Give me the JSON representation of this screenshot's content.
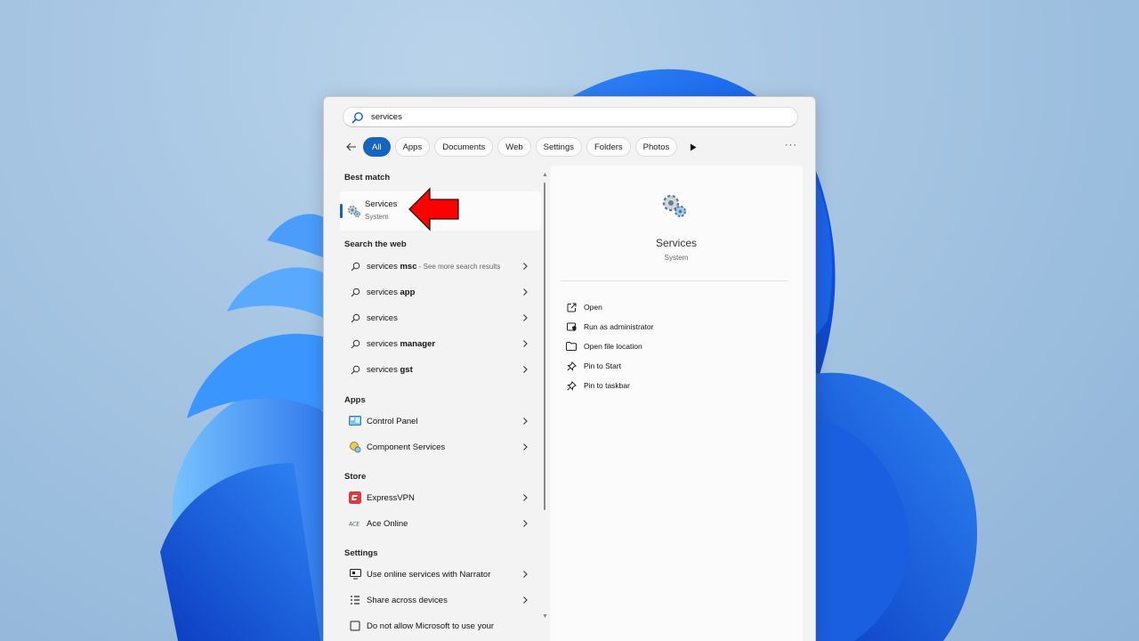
{
  "search": {
    "query": "services"
  },
  "filters": {
    "back_icon": "back-arrow-icon",
    "chips": [
      "All",
      "Apps",
      "Documents",
      "Web",
      "Settings",
      "Folders",
      "Photos"
    ],
    "more_label": "···"
  },
  "results": {
    "best_match_heading": "Best match",
    "best_match": {
      "title": "Services",
      "subtitle": "System",
      "icon": "services-gear-icon"
    },
    "web_heading": "Search the web",
    "web_items": [
      {
        "prefix": "services ",
        "bold": "msc",
        "suffix": " - See more search results"
      },
      {
        "prefix": "services ",
        "bold": "app",
        "suffix": ""
      },
      {
        "prefix": "services",
        "bold": "",
        "suffix": ""
      },
      {
        "prefix": "services ",
        "bold": "manager",
        "suffix": ""
      },
      {
        "prefix": "services ",
        "bold": "gst",
        "suffix": ""
      }
    ],
    "apps_heading": "Apps",
    "apps": [
      {
        "label": "Control Panel",
        "icon": "control-panel-icon"
      },
      {
        "label": "Component Services",
        "icon": "component-services-icon"
      }
    ],
    "store_heading": "Store",
    "store": [
      {
        "label": "ExpressVPN",
        "icon": "expressvpn-icon"
      },
      {
        "label": "Ace Online",
        "icon": "ace-online-icon"
      }
    ],
    "settings_heading": "Settings",
    "settings": [
      {
        "label": "Use online services with Narrator",
        "icon": "narrator-icon"
      },
      {
        "label": "Share across devices",
        "icon": "share-devices-icon"
      },
      {
        "label": "Do not allow Microsoft to use your",
        "icon": "privacy-icon"
      }
    ]
  },
  "preview": {
    "title": "Services",
    "subtitle": "System",
    "actions": [
      {
        "label": "Open",
        "icon": "open-icon"
      },
      {
        "label": "Run as administrator",
        "icon": "shield-icon"
      },
      {
        "label": "Open file location",
        "icon": "folder-icon"
      },
      {
        "label": "Pin to Start",
        "icon": "pin-icon"
      },
      {
        "label": "Pin to taskbar",
        "icon": "pin-icon"
      }
    ]
  },
  "colors": {
    "accent": "#1464c0",
    "annotation_arrow": "#ff0000"
  }
}
